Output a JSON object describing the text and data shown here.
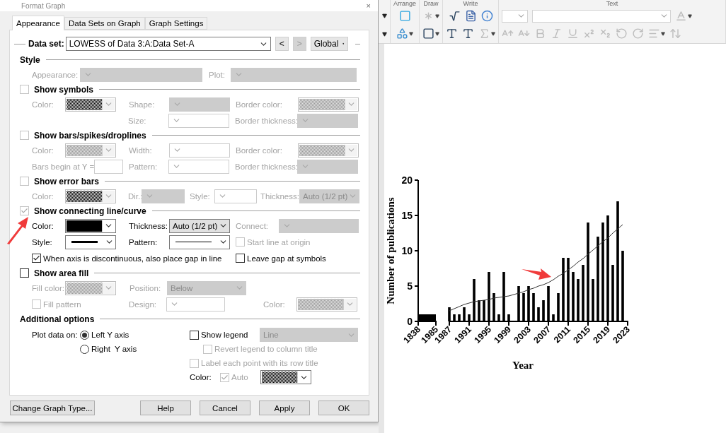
{
  "dialog": {
    "title": "Format Graph",
    "close": "×",
    "tabs": [
      {
        "label": "Appearance",
        "selected": true
      },
      {
        "label": "Data Sets on Graph",
        "selected": false
      },
      {
        "label": "Graph Settings",
        "selected": false
      }
    ],
    "data_set": {
      "label": "Data set:",
      "value": "LOWESS of Data 3:A:Data Set-A",
      "previous": {
        "label": "<",
        "disabled": false
      },
      "next": {
        "label": ">",
        "disabled": true
      },
      "scope": "Global"
    },
    "sections": [
      {
        "title": "Style",
        "kind": "heading",
        "rows": [
          {
            "kind": "style",
            "fields": [
              {
                "label": "Appearance:",
                "kind": "dropdown",
                "disabled": true
              },
              {
                "label": "Plot:",
                "kind": "dropdown",
                "disabled": true
              }
            ]
          }
        ]
      },
      {
        "title": "Show symbols",
        "kind": "check",
        "checked": false,
        "disabled": true,
        "rows": [
          {
            "kind": "triple",
            "fields": [
              {
                "label": "Color:",
                "kind": "swatch",
                "color": "#000000",
                "pattern": true,
                "disabled": true
              },
              {
                "label": "Shape:",
                "kind": "dropdown",
                "disabled": true
              },
              {
                "label": "Border color:",
                "kind": "swatch",
                "color": "#9a9a9a",
                "pattern": true,
                "disabled": true
              }
            ]
          },
          {
            "kind": "right2",
            "fields": [
              {
                "label": "Size:",
                "kind": "combo",
                "disabled": true
              },
              {
                "label": "Border thickness:",
                "kind": "dropdown",
                "disabled": true
              }
            ]
          }
        ]
      },
      {
        "title": "Show bars/spikes/droplines",
        "kind": "check",
        "checked": false,
        "disabled": true,
        "rows": [
          {
            "kind": "triple",
            "fields": [
              {
                "label": "Color:",
                "kind": "swatch",
                "color": "#9a9a9a",
                "pattern": true,
                "disabled": true
              },
              {
                "label": "Width:",
                "kind": "combo",
                "disabled": true
              },
              {
                "label": "Border color:",
                "kind": "swatch",
                "color": "#9a9a9a",
                "pattern": true,
                "disabled": true
              }
            ]
          },
          {
            "kind": "bars2",
            "fields": [
              {
                "label": "Bars begin at Y =",
                "kind": "input",
                "disabled": true
              },
              {
                "label": "Pattern:",
                "kind": "combo",
                "disabled": true
              },
              {
                "label": "Border thickness:",
                "kind": "dropdown",
                "disabled": true
              }
            ]
          }
        ]
      },
      {
        "title": "Show error bars",
        "kind": "check",
        "checked": false,
        "disabled": true,
        "rows": [
          {
            "kind": "errors",
            "fields": [
              {
                "label": "Color:",
                "kind": "swatch",
                "color": "#000000",
                "pattern": true,
                "disabled": true
              },
              {
                "label": "Dir.:",
                "kind": "dropdown",
                "disabled": true
              },
              {
                "label": "Style:",
                "kind": "combo",
                "disabled": true
              },
              {
                "label": "Thickness:",
                "kind": "dropdown",
                "value": "Auto (1/2 pt)",
                "disabled": true
              }
            ]
          }
        ]
      },
      {
        "title": "Show connecting line/curve",
        "kind": "check",
        "checked": true,
        "disabled": true,
        "rows": [
          {
            "kind": "connect",
            "fields": [
              {
                "label": "Color:",
                "kind": "swatch",
                "color": "#000000",
                "pattern": false,
                "disabled": false
              },
              {
                "label": "Thickness:",
                "kind": "dropdown",
                "value": "Auto (1/2 pt)",
                "disabled": false
              },
              {
                "label": "Connect:",
                "kind": "dropdown",
                "disabled": true
              }
            ]
          },
          {
            "kind": "triple",
            "fields": [
              {
                "label": "Style:",
                "kind": "line",
                "thick": true,
                "disabled": false
              },
              {
                "label": "Pattern:",
                "kind": "line",
                "thick": false,
                "disabled": false
              },
              {
                "label": "Start line at origin",
                "kind": "check",
                "checked": false,
                "disabled": true
              }
            ]
          },
          {
            "kind": "checks",
            "fields": [
              {
                "label": "When axis is discontinuous, also place gap in line",
                "kind": "check",
                "checked": true,
                "disabled": false
              },
              {
                "label": "Leave gap at symbols",
                "kind": "check",
                "checked": false,
                "disabled": false
              }
            ]
          }
        ]
      },
      {
        "title": "Show area fill",
        "kind": "check",
        "checked": false,
        "disabled": false,
        "rows": [
          {
            "kind": "pair",
            "fields": [
              {
                "label": "Fill color:",
                "kind": "swatch",
                "color": "#9a9a9a",
                "pattern": true,
                "disabled": true
              },
              {
                "label": "Position:",
                "kind": "dropdown",
                "value": "Below",
                "disabled": true
              }
            ]
          },
          {
            "kind": "area2",
            "fields": [
              {
                "label": "Fill pattern",
                "kind": "check",
                "checked": false,
                "disabled": true
              },
              {
                "label": "Design:",
                "kind": "combo",
                "disabled": true
              },
              {
                "label": "Color:",
                "kind": "swatch",
                "color": "#9a9a9a",
                "pattern": true,
                "disabled": true
              }
            ]
          }
        ]
      }
    ],
    "additional": {
      "title": "Additional options",
      "plot_on": {
        "label": "Plot data on:",
        "options": [
          {
            "label": "Left Y axis",
            "selected": true
          },
          {
            "label": "Right  Y axis",
            "selected": false
          }
        ]
      },
      "legend": {
        "label": "Show legend",
        "checked": false,
        "disabled": false,
        "style": {
          "value": "Line",
          "disabled": true
        }
      },
      "revert": {
        "label": "Revert legend to column title",
        "checked": false,
        "disabled": true
      },
      "row_title": {
        "label": "Label each point with its row title",
        "checked": false,
        "disabled": true
      },
      "color": {
        "label": "Color:",
        "auto": {
          "label": "Auto",
          "checked": true,
          "disabled": true
        },
        "color": "#000000",
        "pattern": true,
        "disabled": false
      }
    },
    "buttons": [
      {
        "label": "Change Graph Type..."
      },
      {
        "label": "Help"
      },
      {
        "label": "Cancel"
      },
      {
        "label": "Apply"
      },
      {
        "label": "OK"
      }
    ]
  },
  "toolbar": {
    "groups": [
      {
        "label": "Arrange",
        "rows": [
          [
            {
              "kind": "select-box",
              "disabled": false
            }
          ],
          [
            {
              "kind": "group",
              "disabled": false
            }
          ]
        ]
      },
      {
        "label": "Draw",
        "rows": [
          [
            {
              "kind": "asterisk-line",
              "disabled": true
            }
          ],
          [
            {
              "kind": "rectangle",
              "disabled": false
            }
          ]
        ]
      },
      {
        "label": "Write",
        "rows": [
          [
            {
              "kind": "equation",
              "disabled": false
            },
            {
              "kind": "word",
              "disabled": false
            },
            {
              "kind": "info",
              "disabled": false
            }
          ],
          [
            {
              "kind": "text",
              "disabled": false
            },
            {
              "kind": "text-box",
              "disabled": false
            },
            {
              "kind": "symbol",
              "disabled": true
            }
          ]
        ]
      },
      {
        "label": "Text",
        "rows": [
          [
            {
              "kind": "font-size",
              "disabled": true
            },
            {
              "kind": "font-name",
              "disabled": true
            },
            {
              "kind": "font-color",
              "disabled": true
            }
          ],
          [
            {
              "kind": "grow",
              "disabled": true
            },
            {
              "kind": "shrink",
              "disabled": true
            },
            {
              "kind": "bold",
              "disabled": true
            },
            {
              "kind": "italic",
              "disabled": true
            },
            {
              "kind": "underline",
              "disabled": true
            },
            {
              "kind": "superscript",
              "disabled": true
            },
            {
              "kind": "subscript",
              "disabled": true
            },
            {
              "kind": "rotate-left",
              "disabled": true
            },
            {
              "kind": "rotate-right",
              "disabled": true
            },
            {
              "kind": "align",
              "disabled": true
            },
            {
              "kind": "spacing",
              "disabled": true
            }
          ]
        ]
      }
    ]
  },
  "graph": {
    "charts": [
      {
        "chart_data": {
          "type": "area",
          "ylabel": "Number of publications",
          "x": [
            1838,
            1985
          ],
          "series": [
            {
              "type": "area",
              "color": "#000000",
              "values": [
                1,
                1
              ]
            }
          ],
          "xlim": [
            1838,
            1985
          ],
          "ylim": [
            0,
            20
          ],
          "yticks": [
            0,
            5,
            10,
            15,
            20
          ],
          "xticks": [
            1838,
            1985
          ]
        }
      },
      {
        "chart_data": {
          "type": "bar",
          "xlabel": "Year",
          "x": [
            1987,
            1988,
            1989,
            1990,
            1991,
            1992,
            1993,
            1994,
            1995,
            1996,
            1997,
            1998,
            1999,
            2000,
            2001,
            2002,
            2003,
            2004,
            2005,
            2006,
            2007,
            2008,
            2009,
            2010,
            2011,
            2012,
            2013,
            2014,
            2015,
            2016,
            2017,
            2018,
            2019,
            2020,
            2021,
            2022
          ],
          "series": [
            {
              "type": "bar",
              "color": "#000000",
              "values": [
                2,
                1,
                1,
                2,
                1,
                6,
                3,
                3,
                7,
                4,
                1,
                7,
                1,
                0,
                5,
                4,
                5,
                4,
                2,
                3,
                5,
                1,
                4,
                9,
                9,
                7,
                6,
                8,
                14,
                6,
                12,
                14,
                15,
                8,
                17,
                10
              ]
            },
            {
              "type": "line",
              "color": "#333333",
              "values": [
                1.5,
                1.8,
                2.1,
                2.4,
                2.6,
                2.8,
                2.9,
                3.0,
                3.1,
                3.3,
                3.4,
                3.5,
                3.6,
                3.8,
                4.0,
                4.2,
                4.5,
                4.7,
                5.0,
                5.2,
                5.5,
                5.9,
                6.4,
                6.8,
                7.3,
                7.8,
                8.4,
                8.9,
                9.5,
                10.1,
                10.7,
                11.3,
                11.8,
                12.5,
                13.1,
                13.7
              ]
            }
          ],
          "xlim": [
            1987,
            2023
          ],
          "ylim": [
            0,
            20
          ],
          "xticks": [
            1987,
            1991,
            1995,
            1999,
            2003,
            2007,
            2011,
            2015,
            2019,
            2023
          ]
        }
      }
    ]
  }
}
